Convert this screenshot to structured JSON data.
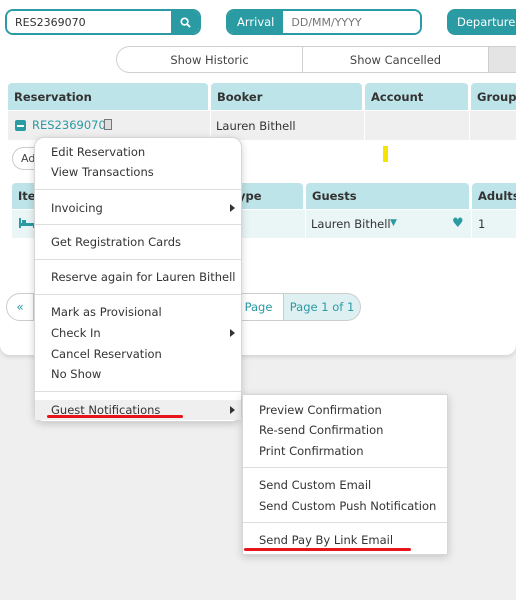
{
  "search": {
    "value": "RES2369070",
    "button": "search-icon"
  },
  "arrival": {
    "label": "Arrival",
    "placeholder": "DD/MM/YYYY"
  },
  "departure": {
    "label": "Departure"
  },
  "toggles": {
    "historic": "Show Historic",
    "cancelled": "Show Cancelled"
  },
  "table": {
    "headers": [
      "Reservation",
      "Booker",
      "Account",
      "Group"
    ],
    "row": {
      "reservation": "RES2369070",
      "booker": "Lauren Bithell"
    }
  },
  "add_button": "Ad",
  "inner_table": {
    "headers": [
      "Ite",
      "ype",
      "Guests",
      "Adults"
    ],
    "row": {
      "guest": "Lauren Bithell",
      "adults": "1"
    }
  },
  "pager": {
    "first": "«",
    "page": "Page",
    "info": "Page 1 of 1"
  },
  "context_menu": {
    "edit": "Edit Reservation",
    "view": "View Transactions",
    "invoicing": "Invoicing",
    "cards": "Get Registration Cards",
    "reserve_again": "Reserve again for Lauren Bithell",
    "provisional": "Mark as Provisional",
    "check_in": "Check In",
    "cancel": "Cancel Reservation",
    "no_show": "No Show",
    "notifications": "Guest Notifications"
  },
  "submenu": {
    "preview": "Preview Confirmation",
    "resend": "Re-send Confirmation",
    "print": "Print Confirmation",
    "custom_email": "Send Custom Email",
    "custom_push": "Send Custom Push Notification",
    "pay_link": "Send Pay By Link Email"
  },
  "colors": {
    "accent": "#2a9aa3",
    "header_bg": "#bde4e8",
    "underline": "#e8141b"
  }
}
